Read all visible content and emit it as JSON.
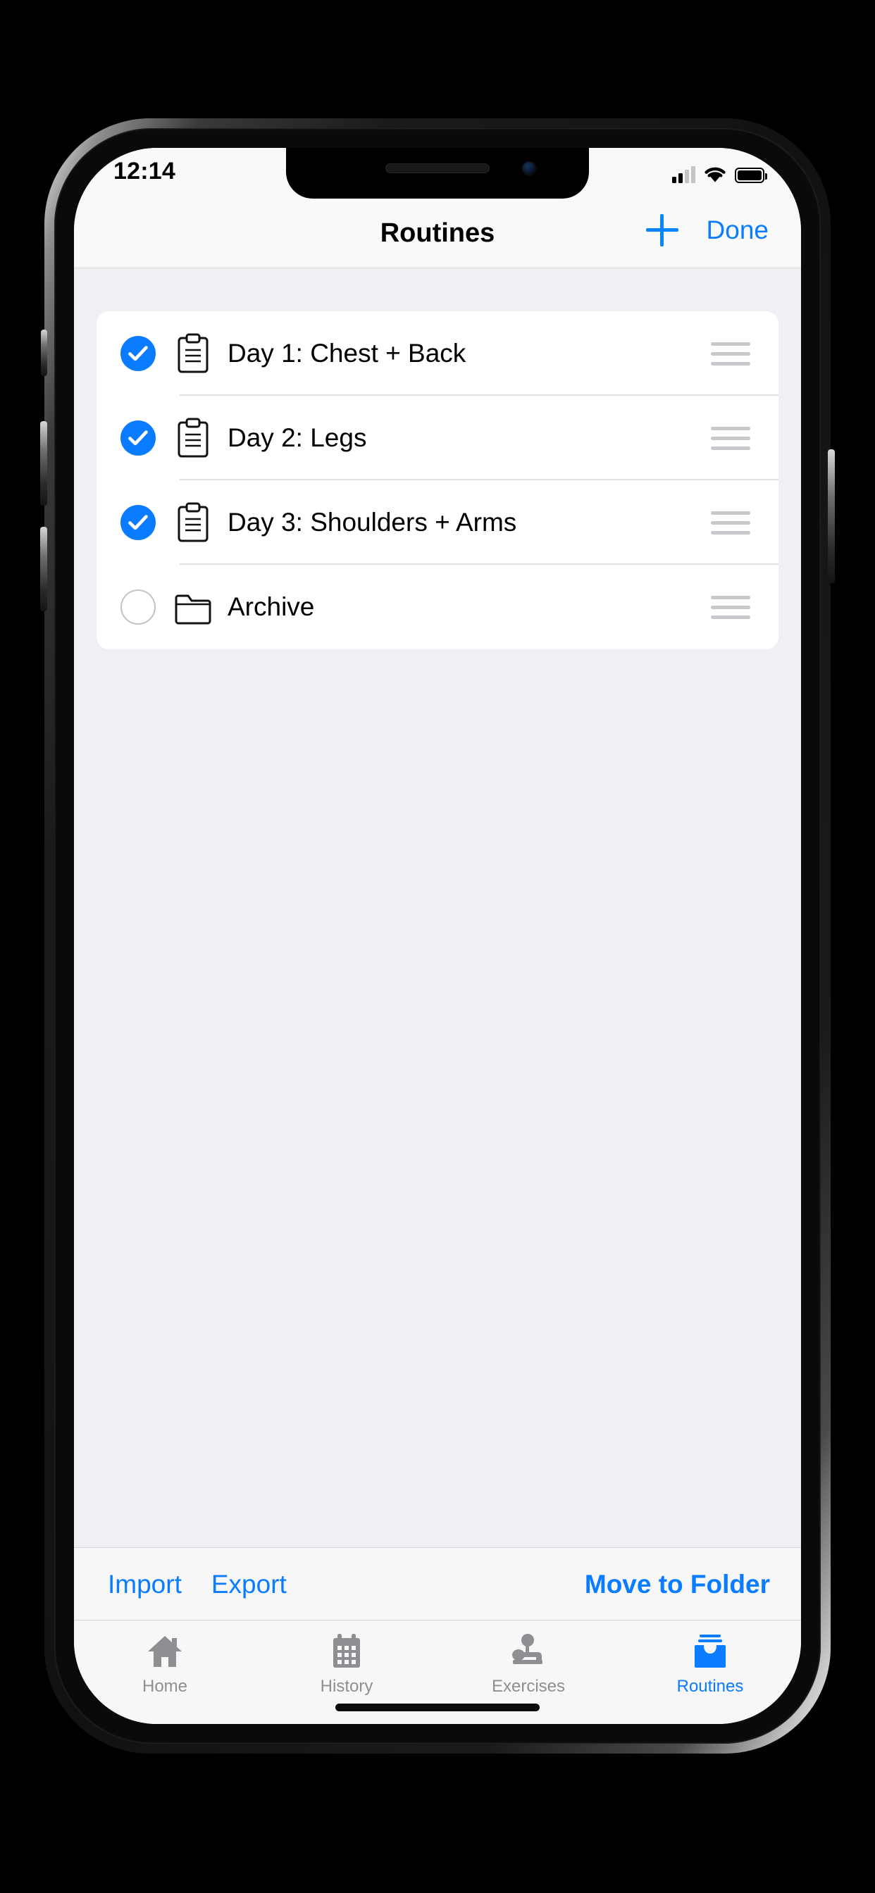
{
  "status_bar": {
    "time": "12:14",
    "cellular_icon": "cellular-signal-icon",
    "cellular_bars_filled": 2,
    "cellular_bars_total": 4,
    "wifi_icon": "wifi-icon",
    "battery_icon": "battery-icon",
    "battery_level_percent": 100
  },
  "nav_bar": {
    "title": "Routines",
    "add_label": "+",
    "add_icon": "plus-icon",
    "done_label": "Done"
  },
  "list": {
    "rows": [
      {
        "label": "Day 1: Chest + Back",
        "checked": true,
        "icon": "clipboard-icon",
        "handle_icon": "drag-handle-icon"
      },
      {
        "label": "Day 2: Legs",
        "checked": true,
        "icon": "clipboard-icon",
        "handle_icon": "drag-handle-icon"
      },
      {
        "label": "Day 3: Shoulders + Arms",
        "checked": true,
        "icon": "clipboard-icon",
        "handle_icon": "drag-handle-icon"
      },
      {
        "label": "Archive",
        "checked": false,
        "icon": "folder-icon",
        "handle_icon": "drag-handle-icon"
      }
    ]
  },
  "toolbar": {
    "import_label": "Import",
    "export_label": "Export",
    "move_label": "Move to Folder"
  },
  "tab_bar": {
    "items": [
      {
        "label": "Home",
        "icon": "home-icon",
        "active": false
      },
      {
        "label": "History",
        "icon": "calendar-icon",
        "active": false
      },
      {
        "label": "Exercises",
        "icon": "bench-press-icon",
        "active": false
      },
      {
        "label": "Routines",
        "icon": "tray-icon",
        "active": true
      }
    ]
  },
  "colors": {
    "accent_blue": "#0a7cff",
    "check_blue": "#0a7cff",
    "inactive_gray": "#8e8e93",
    "content_bg": "#eff0f4",
    "bar_bg": "#f9f9f9"
  }
}
